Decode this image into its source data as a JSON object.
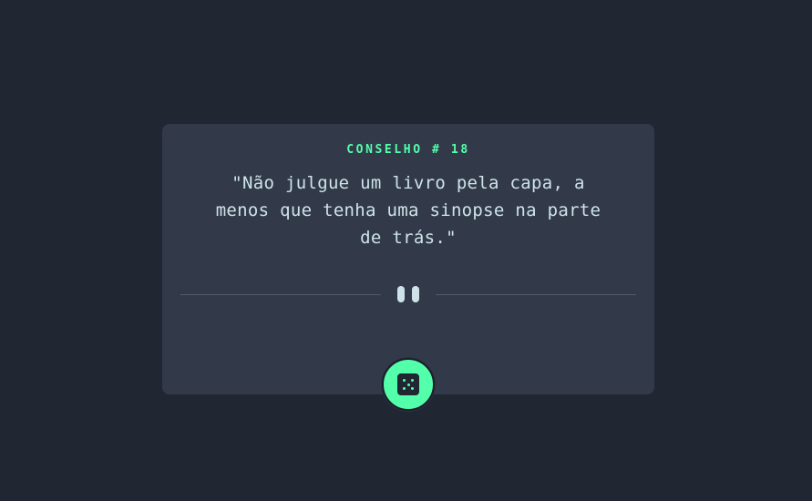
{
  "advice": {
    "id_label": "CONSELHO # 18",
    "text": "\"Não julgue um livro pela capa, a menos que tenha uma sinopse na parte de trás.\""
  },
  "divider": {
    "icon": "pause-icon"
  },
  "button": {
    "icon": "dice-icon"
  },
  "colors": {
    "background": "#202632",
    "card": "#323a4a",
    "accent": "#53ffab",
    "text": "#cee3e9",
    "divider": "#4f5b6b"
  }
}
